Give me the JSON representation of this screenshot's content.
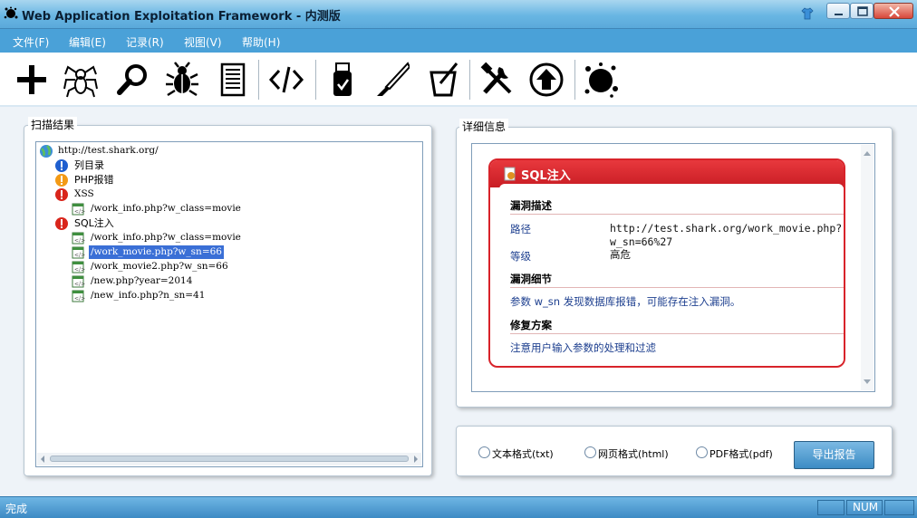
{
  "window": {
    "title": "Web Application Exploitation Framework - 内测版"
  },
  "menu": [
    "文件(F)",
    "编辑(E)",
    "记录(R)",
    "视图(V)",
    "帮助(H)"
  ],
  "toolbar": {
    "icons": [
      "add-icon",
      "spider-icon",
      "search-icon",
      "bug-icon",
      "notepad-icon",
      "code-icon",
      "usb-drive-icon",
      "knife-icon",
      "cup-icon",
      "tools-icon",
      "upload-icon",
      "splat-icon"
    ]
  },
  "scan_results": {
    "title": "扫描结果",
    "root": "http://test.shark.org/",
    "nodes": [
      {
        "label": "列目录",
        "icon": "info-icon"
      },
      {
        "label": "PHP报错",
        "icon": "warning-icon"
      },
      {
        "label": "XSS",
        "icon": "error-icon"
      },
      {
        "label": "/work_info.php?w_class=movie",
        "icon": "page-icon"
      },
      {
        "label": "SQL注入",
        "icon": "error-icon"
      },
      {
        "label": "/work_info.php?w_class=movie",
        "icon": "page-icon"
      },
      {
        "label": "/work_movie.php?w_sn=66",
        "icon": "page-icon",
        "selected": true
      },
      {
        "label": "/work_movie2.php?w_sn=66",
        "icon": "page-icon"
      },
      {
        "label": "/new.php?year=2014",
        "icon": "page-icon"
      },
      {
        "label": "/new_info.php?n_sn=41",
        "icon": "page-icon"
      }
    ]
  },
  "details": {
    "title": "详细信息",
    "vuln_name": "SQL注入",
    "sec_desc": "漏洞描述",
    "path_key": "路径",
    "path_val_1": "http://test.shark.org/work_movie.php?",
    "path_val_2": "w_sn=66%27",
    "level_key": "等级",
    "level_val": "高危",
    "sec_detail": "漏洞细节",
    "detail_text": "参数 w_sn 发现数据库报错，可能存在注入漏洞。",
    "sec_fix": "修复方案",
    "fix_text": "注意用户输入参数的处理和过滤"
  },
  "export": {
    "opt_txt": "文本格式(txt)",
    "opt_html": "网页格式(html)",
    "opt_pdf": "PDF格式(pdf)",
    "button": "导出报告"
  },
  "status": {
    "text": "完成",
    "num": "NUM"
  },
  "colors": {
    "titlebar": "#69b6e3",
    "menubar": "#4aa1d8",
    "card_red": "#d8232a",
    "selection": "#3a6fd6",
    "link_blue": "#1d3f8f"
  }
}
